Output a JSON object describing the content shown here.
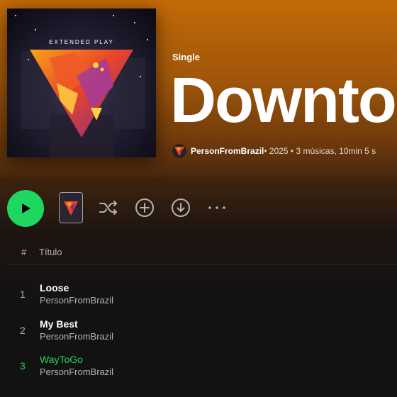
{
  "album": {
    "type_label": "Single",
    "title": "Downto",
    "cover_text": "EXTENDED PLAY",
    "artist": "PersonFromBrazil",
    "details": " • 2025 • 3 músicas, 10min 5 s"
  },
  "controls": {
    "play": "play-icon",
    "shuffle": "shuffle-icon",
    "add": "plus-circle-icon",
    "download": "download-icon",
    "more": "more-icon"
  },
  "table": {
    "num_header": "#",
    "title_header": "Título"
  },
  "tracks": [
    {
      "number": "1",
      "name": "Loose",
      "artist": "PersonFromBrazil"
    },
    {
      "number": "2",
      "name": "My Best",
      "artist": "PersonFromBrazil"
    },
    {
      "number": "3",
      "name": "WayToGo",
      "artist": "PersonFromBrazil"
    }
  ],
  "colors": {
    "accent": "#1ed760",
    "header": "#c26a08"
  }
}
